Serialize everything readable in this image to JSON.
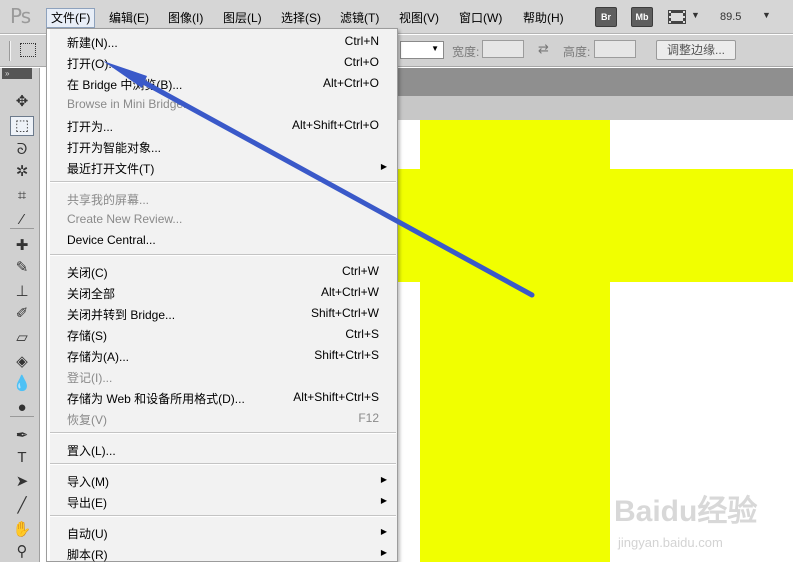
{
  "app": {
    "logo": "Ps"
  },
  "menubar": {
    "items": [
      {
        "label": "文件(F)",
        "active": true
      },
      {
        "label": "编辑(E)"
      },
      {
        "label": "图像(I)"
      },
      {
        "label": "图层(L)"
      },
      {
        "label": "选择(S)"
      },
      {
        "label": "滤镜(T)"
      },
      {
        "label": "视图(V)"
      },
      {
        "label": "窗口(W)"
      },
      {
        "label": "帮助(H)"
      }
    ],
    "bridge_btn": "Br",
    "minibridge_btn": "Mb",
    "zoom": "89.5"
  },
  "options": {
    "width_label": "宽度:",
    "height_label": "高度:",
    "refine_edge": "调整边缘..."
  },
  "file_menu": {
    "items": [
      {
        "label": "新建(N)...",
        "shortcut": "Ctrl+N"
      },
      {
        "label": "打开(O)...",
        "shortcut": "Ctrl+O"
      },
      {
        "label": "在 Bridge 中浏览(B)...",
        "shortcut": "Alt+Ctrl+O"
      },
      {
        "label": "Browse in Mini Bridge...",
        "shortcut": "",
        "disabled": true
      },
      {
        "label": "打开为...",
        "shortcut": "Alt+Shift+Ctrl+O"
      },
      {
        "label": "打开为智能对象...",
        "shortcut": ""
      },
      {
        "label": "最近打开文件(T)",
        "shortcut": "",
        "submenu": true
      },
      {
        "separator": true
      },
      {
        "label": "共享我的屏幕...",
        "shortcut": "",
        "disabled": true
      },
      {
        "label": "Create New Review...",
        "shortcut": "",
        "disabled": true
      },
      {
        "label": "Device Central...",
        "shortcut": ""
      },
      {
        "separator": true
      },
      {
        "label": "关闭(C)",
        "shortcut": "Ctrl+W"
      },
      {
        "label": "关闭全部",
        "shortcut": "Alt+Ctrl+W"
      },
      {
        "label": "关闭并转到 Bridge...",
        "shortcut": "Shift+Ctrl+W"
      },
      {
        "label": "存储(S)",
        "shortcut": "Ctrl+S"
      },
      {
        "label": "存储为(A)...",
        "shortcut": "Shift+Ctrl+S"
      },
      {
        "label": "登记(I)...",
        "shortcut": "",
        "disabled": true
      },
      {
        "label": "存储为 Web 和设备所用格式(D)...",
        "shortcut": "Alt+Shift+Ctrl+S"
      },
      {
        "label": "恢复(V)",
        "shortcut": "F12",
        "disabled": true
      },
      {
        "separator": true
      },
      {
        "label": "置入(L)...",
        "shortcut": ""
      },
      {
        "separator": true
      },
      {
        "label": "导入(M)",
        "shortcut": "",
        "submenu": true
      },
      {
        "label": "导出(E)",
        "shortcut": "",
        "submenu": true
      },
      {
        "separator": true
      },
      {
        "label": "自动(U)",
        "shortcut": "",
        "submenu": true
      },
      {
        "label": "脚本(R)",
        "shortcut": "",
        "submenu": true
      }
    ]
  },
  "tools": [
    {
      "name": "move-tool",
      "glyph": "✥"
    },
    {
      "name": "rectangular-marquee-tool",
      "glyph": "⬚",
      "selected": true
    },
    {
      "name": "lasso-tool",
      "glyph": "ᘐ"
    },
    {
      "name": "quick-selection-tool",
      "glyph": "✲"
    },
    {
      "name": "crop-tool",
      "glyph": "⌗"
    },
    {
      "name": "eyedropper-tool",
      "glyph": "⁄"
    },
    {
      "name": "spot-healing-tool",
      "glyph": "✚"
    },
    {
      "name": "brush-tool",
      "glyph": "✎"
    },
    {
      "name": "clone-stamp-tool",
      "glyph": "⊥"
    },
    {
      "name": "history-brush-tool",
      "glyph": "✐"
    },
    {
      "name": "eraser-tool",
      "glyph": "▱"
    },
    {
      "name": "paint-bucket-tool",
      "glyph": "◈"
    },
    {
      "name": "blur-tool",
      "glyph": "💧"
    },
    {
      "name": "dodge-tool",
      "glyph": "●"
    },
    {
      "name": "pen-tool",
      "glyph": "✒"
    },
    {
      "name": "type-tool",
      "glyph": "T"
    },
    {
      "name": "path-selection-tool",
      "glyph": "➤"
    },
    {
      "name": "line-tool",
      "glyph": "╱"
    },
    {
      "name": "hand-tool",
      "glyph": "✋"
    },
    {
      "name": "zoom-tool",
      "glyph": "⚲"
    }
  ],
  "watermark": {
    "logo": "Baidu经验",
    "url": "jingyan.baidu.com"
  },
  "colors": {
    "canvas_yellow": "#f1ff00",
    "annotation_arrow": "#3a59c9"
  }
}
